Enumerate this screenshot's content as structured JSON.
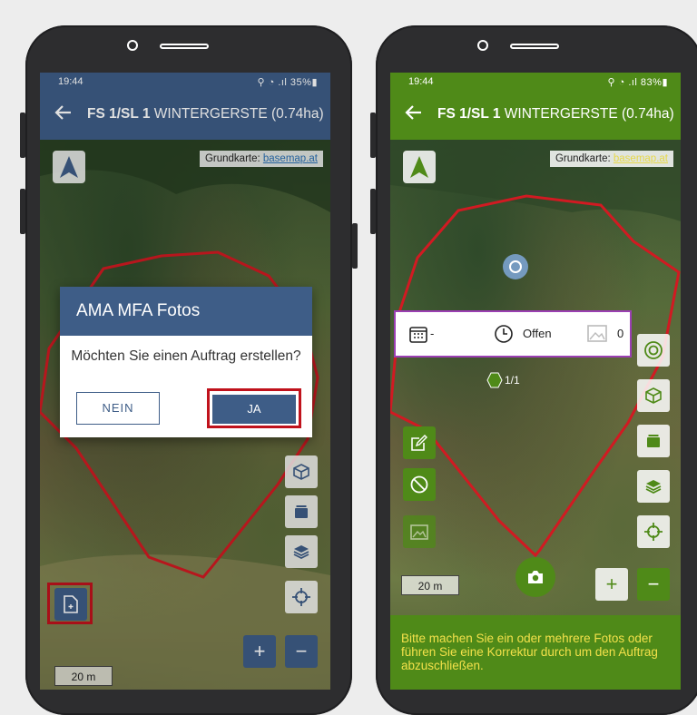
{
  "colors": {
    "appbar_blue": "#3e5d87",
    "appbar_green": "#4f8a18",
    "highlight_red": "#c0121c",
    "field_outline": "#d11a22",
    "instruction_text": "#f3e14a",
    "card_border": "#9b3fb3"
  },
  "left": {
    "status": {
      "time": "19:44",
      "system": "⚲ ◔ .ıl 35%▮"
    },
    "appbar": {
      "back_icon": "arrow-left-icon",
      "title_bold": "FS 1/SL 1",
      "title_rest": " WINTERGERSTE (0.74ha)"
    },
    "basemap": {
      "label": "Grundkarte: ",
      "link": "basemap.at"
    },
    "scale": "20 m",
    "dialog": {
      "title": "AMA MFA Fotos",
      "message": "Möchten Sie einen Auftrag erstellen?",
      "no": "NEIN",
      "yes": "JA"
    },
    "icons": [
      "compass-north-icon",
      "new-document-icon",
      "cube-icon",
      "stack-icon",
      "layers-icon",
      "crosshair-icon",
      "plus-icon",
      "minus-icon"
    ],
    "zoom_in": "+",
    "zoom_out": "−"
  },
  "right": {
    "status": {
      "time": "19:44",
      "system": "⚲ ◔ .ıl 83%▮"
    },
    "appbar": {
      "back_icon": "arrow-left-icon",
      "title_bold": "FS 1/SL 1",
      "title_rest": " WINTERGERSTE (0.74ha)"
    },
    "basemap": {
      "label": "Grundkarte: ",
      "link": "basemap.at"
    },
    "scale": "20 m",
    "card": {
      "date": "-",
      "status": "Offen",
      "photo_count": "0"
    },
    "marker_label": "1/1",
    "zoom_in": "+",
    "zoom_out": "−",
    "instruction": "Bitte machen Sie ein oder mehrere Fotos oder führen Sie eine Korrektur durch um den Auftrag abzuschließen.",
    "icons": [
      "compass-north-icon",
      "target-icon",
      "cube-icon",
      "stack-icon",
      "layers-icon",
      "crosshair-icon",
      "edit-icon",
      "forbidden-icon",
      "gallery-icon",
      "camera-icon",
      "calendar-icon",
      "clock-icon",
      "photo-icon"
    ]
  }
}
